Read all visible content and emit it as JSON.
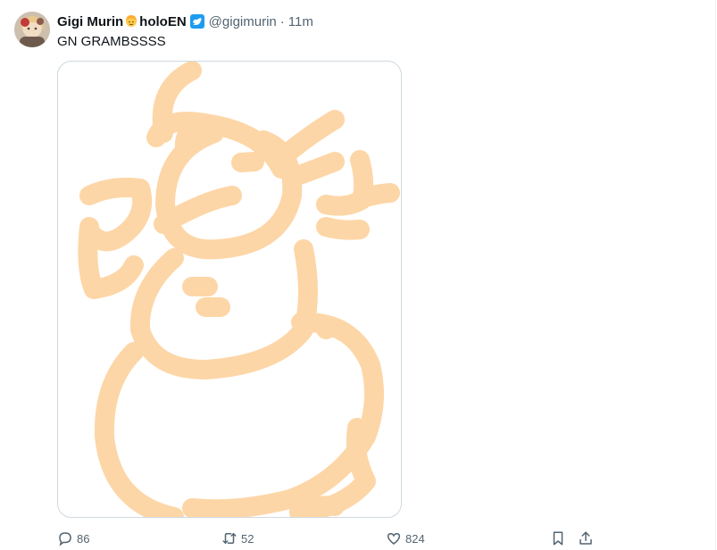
{
  "tweet": {
    "display_name": "Gigi Murin",
    "display_name_suffix": "holoEN",
    "name_emoji": "blonde-person-emoji",
    "handle": "@gigimurin",
    "separator": "·",
    "time": "11m",
    "text": "GN GRAMBSSSS",
    "media": {
      "description_icon": "snowman-sketch",
      "stroke_color": "#fdd3a0"
    }
  },
  "actions": {
    "reply": {
      "icon": "reply-icon",
      "count": "86"
    },
    "retweet": {
      "icon": "retweet-icon",
      "count": "52"
    },
    "like": {
      "icon": "heart-icon",
      "count": "824"
    },
    "bookmark": {
      "icon": "bookmark-icon"
    },
    "share": {
      "icon": "share-icon"
    }
  },
  "colors": {
    "text_primary": "#0f1419",
    "text_secondary": "#536471",
    "verified": "#1d9bf0",
    "border": "#cfd9de"
  }
}
